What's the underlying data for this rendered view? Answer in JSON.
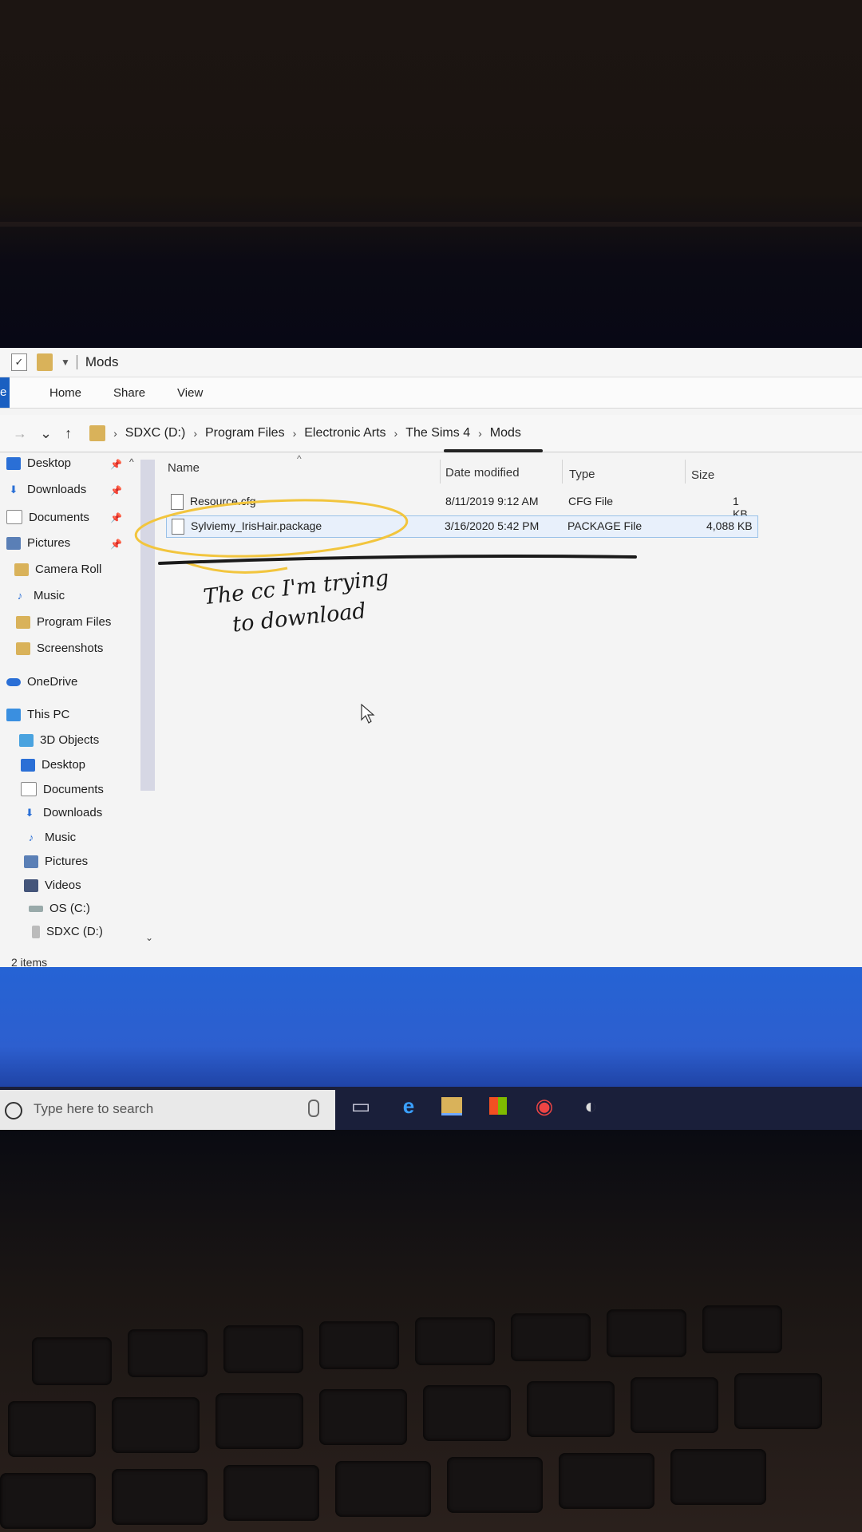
{
  "window": {
    "title": "Mods"
  },
  "ribbon": {
    "file_tab": "e",
    "tabs": [
      "Home",
      "Share",
      "View"
    ]
  },
  "address": {
    "back": "→",
    "recent": "⌄",
    "up": "↑",
    "crumbs": [
      "SDXC (D:)",
      "Program Files",
      "Electronic Arts",
      "The Sims 4",
      "Mods"
    ]
  },
  "nav": {
    "quick_access": [
      {
        "label": "Desktop",
        "icon": "desktop-icon",
        "pinned": true
      },
      {
        "label": "Downloads",
        "icon": "download-icon",
        "pinned": true
      },
      {
        "label": "Documents",
        "icon": "documents-icon",
        "pinned": true
      },
      {
        "label": "Pictures",
        "icon": "pictures-icon",
        "pinned": true
      },
      {
        "label": "Camera Roll",
        "icon": "folder-icon",
        "pinned": false
      },
      {
        "label": "Music",
        "icon": "music-icon",
        "pinned": false
      },
      {
        "label": "Program Files",
        "icon": "folder-icon",
        "pinned": false
      },
      {
        "label": "Screenshots",
        "icon": "folder-icon",
        "pinned": false
      }
    ],
    "onedrive": "OneDrive",
    "this_pc": "This PC",
    "pc_items": [
      "3D Objects",
      "Desktop",
      "Documents",
      "Downloads",
      "Music",
      "Pictures",
      "Videos",
      "OS (C:)",
      "SDXC (D:)"
    ]
  },
  "columns": {
    "name": "Name",
    "date": "Date modified",
    "type": "Type",
    "size": "Size"
  },
  "files": [
    {
      "name": "Resource.cfg",
      "date": "8/11/2019 9:12 AM",
      "type": "CFG File",
      "size": "1 KB"
    },
    {
      "name": "Sylviemy_IrisHair.package",
      "date": "3/16/2020 5:42 PM",
      "type": "PACKAGE File",
      "size": "4,088 KB"
    }
  ],
  "status": {
    "items": "2 items"
  },
  "taskbar": {
    "search_placeholder": "Type here to search"
  },
  "annotation": {
    "line1": "The cc I'm trying",
    "line2": "to download"
  },
  "colors": {
    "accent": "#1a5fc1",
    "highlight": "#f2c53d",
    "desktop": "#2563d4"
  }
}
